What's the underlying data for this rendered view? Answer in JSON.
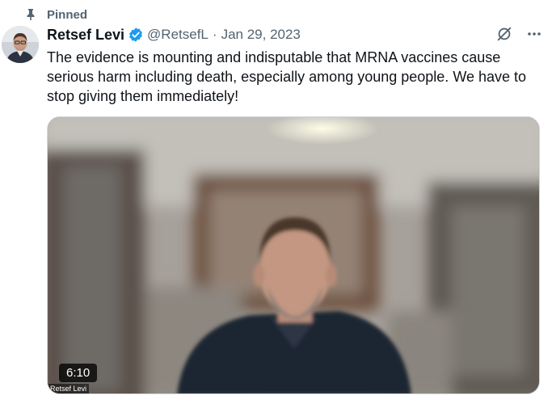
{
  "tweet": {
    "pinned_label": "Pinned",
    "author": {
      "display_name": "Retsef Levi",
      "handle": "@RetsefL",
      "verified": true
    },
    "separator": "·",
    "date": "Jan 29, 2023",
    "text": "The evidence is mounting and indisputable that MRNA vaccines cause serious harm including death, especially among young people. We have to stop giving them immediately!",
    "media": {
      "type": "video",
      "duration": "6:10",
      "speaker_tag": "Retsef Levi"
    }
  },
  "icons": {
    "pin": "pin-icon",
    "verified": "verified-badge-icon",
    "grok": "grok-icon",
    "more": "more-icon"
  },
  "colors": {
    "verified_blue": "#1d9bf0",
    "secondary_text": "#536471",
    "primary_text": "#0f1419"
  }
}
